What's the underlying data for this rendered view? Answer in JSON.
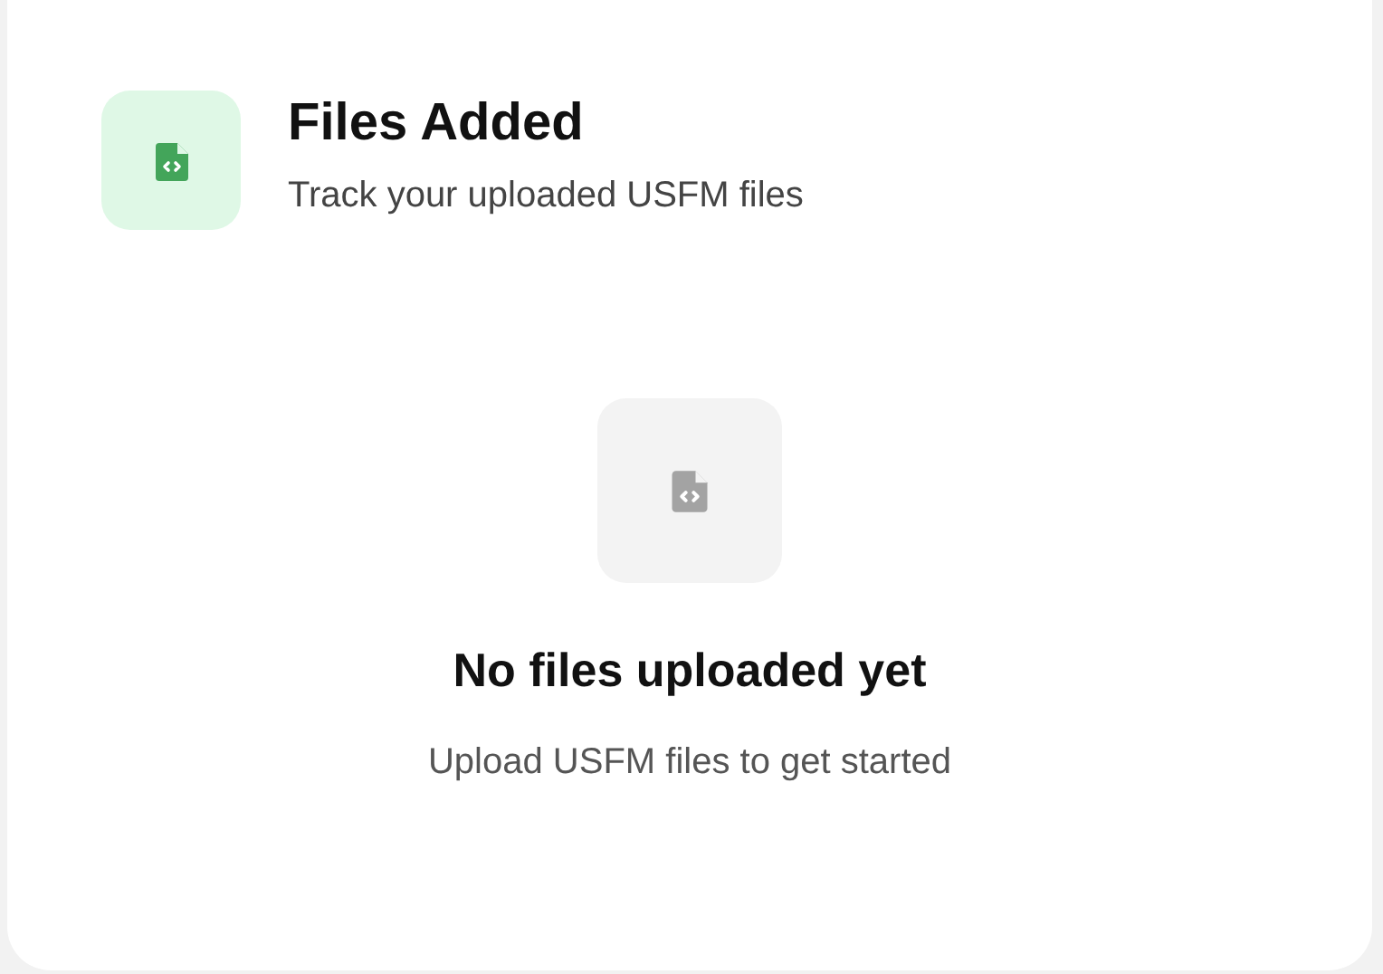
{
  "header": {
    "title": "Files Added",
    "subtitle": "Track your uploaded USFM files"
  },
  "empty_state": {
    "title": "No files uploaded yet",
    "message": "Upload USFM files to get started"
  }
}
